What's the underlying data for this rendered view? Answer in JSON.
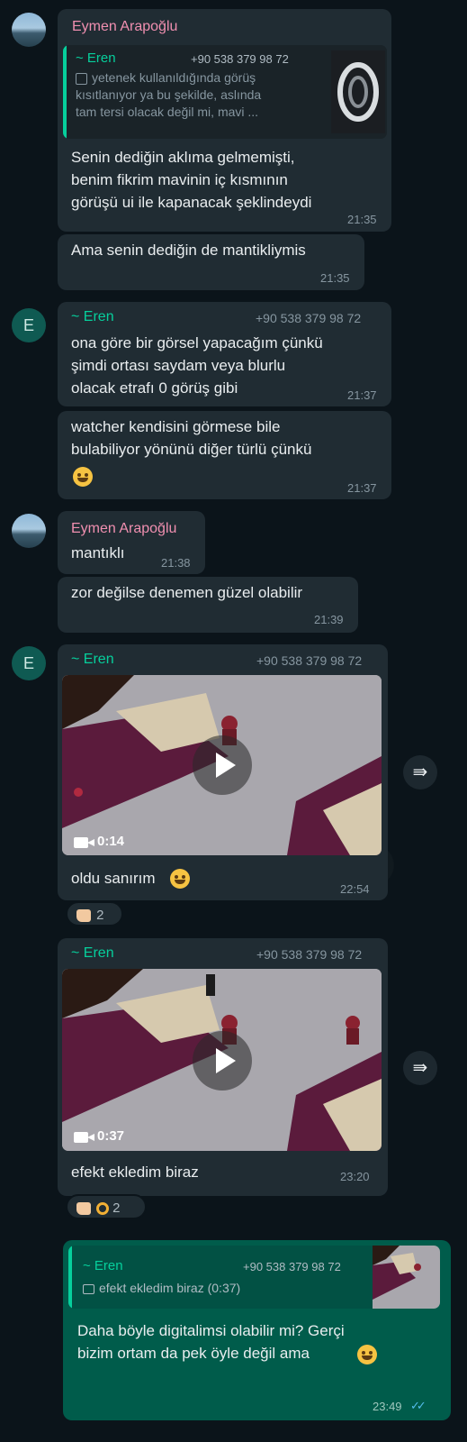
{
  "messages": {
    "m1": {
      "sender": "Eymen Arapoğlu",
      "quote": {
        "name": "~ Eren",
        "phone": "+90 538 379 98 72",
        "line1": "yetenek kullanıldığında görüş",
        "line2": "kısıtlanıyor ya bu şekilde, aslında",
        "line3": "tam tersi olacak değil mi, mavi ..."
      },
      "line1": "Senin dediğin aklıma gelmemişti,",
      "line2": "benim fikrim mavinin iç kısmının",
      "line3": "görüşü ui ile kapanacak şeklindeydi",
      "time": "21:35"
    },
    "m2": {
      "text": "Ama senin dediğin de mantikliymis",
      "time": "21:35"
    },
    "m3": {
      "avatar_letter": "E",
      "sender": "~ Eren",
      "phone": "+90 538 379 98 72",
      "line1": "ona göre bir görsel yapacağım çünkü",
      "line2": "şimdi ortası saydam veya blurlu",
      "line3": "olacak etrafı 0 görüş gibi",
      "time": "21:37"
    },
    "m4": {
      "line1": "watcher kendisini görmese bile",
      "line2": "bulabiliyor yönünü diğer türlü çünkü",
      "emoji": "grinning-face",
      "time": "21:37"
    },
    "m5": {
      "sender": "Eymen Arapoğlu",
      "text": "mantıklı",
      "time": "21:38"
    },
    "m6": {
      "text": "zor değilse denemen güzel olabilir",
      "time": "21:39"
    },
    "m7": {
      "avatar_letter": "E",
      "sender": "~ Eren",
      "phone": "+90 538 379 98 72",
      "duration": "0:14",
      "caption": "oldu sanırım",
      "time": "22:54",
      "reaction_count": "2"
    },
    "m8": {
      "sender": "~ Eren",
      "phone": "+90 538 379 98 72",
      "duration": "0:37",
      "caption": "efekt ekledim biraz",
      "time": "23:20",
      "reaction_count": "2"
    },
    "m9": {
      "quote": {
        "name": "~ Eren",
        "phone": "+90 538 379 98 72",
        "text": "efekt ekledim biraz (0:37)"
      },
      "line1": "Daha böyle digitalimsi olabilir mi? Gerçi",
      "line2": "bizim ortam da pek öyle değil ama",
      "time": "23:49"
    }
  },
  "colors": {
    "background": "#0b141a",
    "incoming_bubble": "#202c33",
    "outgoing_bubble": "#005c4b",
    "sender_pink": "#f08fb0",
    "sender_green": "#06cf9c",
    "read_ticks": "#53bdeb"
  }
}
